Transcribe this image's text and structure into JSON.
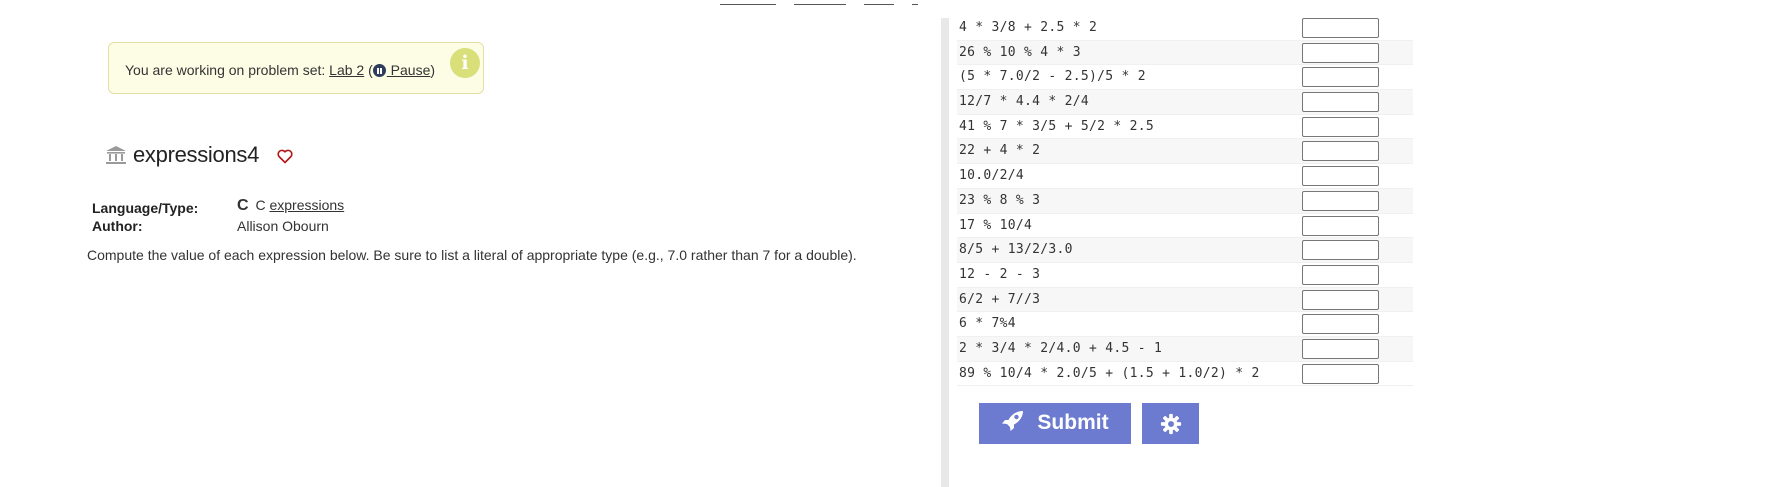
{
  "banner": {
    "prefix": "You are working on problem set: ",
    "problem_set": "Lab 2",
    "open_paren": " (",
    "pause_label": " Pause",
    "close_paren": ")",
    "info_icon": "info-icon"
  },
  "problem": {
    "title": "expressions4",
    "language_label": "Language/Type:",
    "language_logo": "C",
    "language_value": "C",
    "type_link": "expressions",
    "author_label": "Author:",
    "author_value": "Allison Obourn",
    "description": "Compute the value of each expression below. Be sure to list a literal of appropriate type (e.g., 7.0 rather than 7 for a double)."
  },
  "expressions": [
    {
      "expr": "4 * 3/8 + 2.5 * 2",
      "answer": ""
    },
    {
      "expr": "26 % 10 % 4 * 3",
      "answer": ""
    },
    {
      "expr": "(5 * 7.0/2 - 2.5)/5 * 2",
      "answer": ""
    },
    {
      "expr": "12/7 * 4.4 * 2/4",
      "answer": ""
    },
    {
      "expr": "41 % 7 * 3/5 + 5/2 * 2.5",
      "answer": ""
    },
    {
      "expr": "22 + 4 * 2",
      "answer": ""
    },
    {
      "expr": "10.0/2/4",
      "answer": ""
    },
    {
      "expr": "23 % 8 % 3",
      "answer": ""
    },
    {
      "expr": "17 % 10/4",
      "answer": ""
    },
    {
      "expr": "8/5 + 13/2/3.0",
      "answer": ""
    },
    {
      "expr": "12 - 2 - 3",
      "answer": ""
    },
    {
      "expr": "6/2 + 7//3",
      "answer": ""
    },
    {
      "expr": "6 * 7%4",
      "answer": ""
    },
    {
      "expr": "2 * 3/4 * 2/4.0 + 4.5 - 1",
      "answer": ""
    },
    {
      "expr": "89 % 10/4 * 2.0/5 + (1.5 + 1.0/2) * 2",
      "answer": ""
    }
  ],
  "actions": {
    "submit_label": "Submit",
    "settings_icon": "gear-icon"
  },
  "colors": {
    "accent": "#6c7bd0",
    "banner_bg": "#fdfde6",
    "info_icon": "#d9df79",
    "heart": "#b01818"
  }
}
